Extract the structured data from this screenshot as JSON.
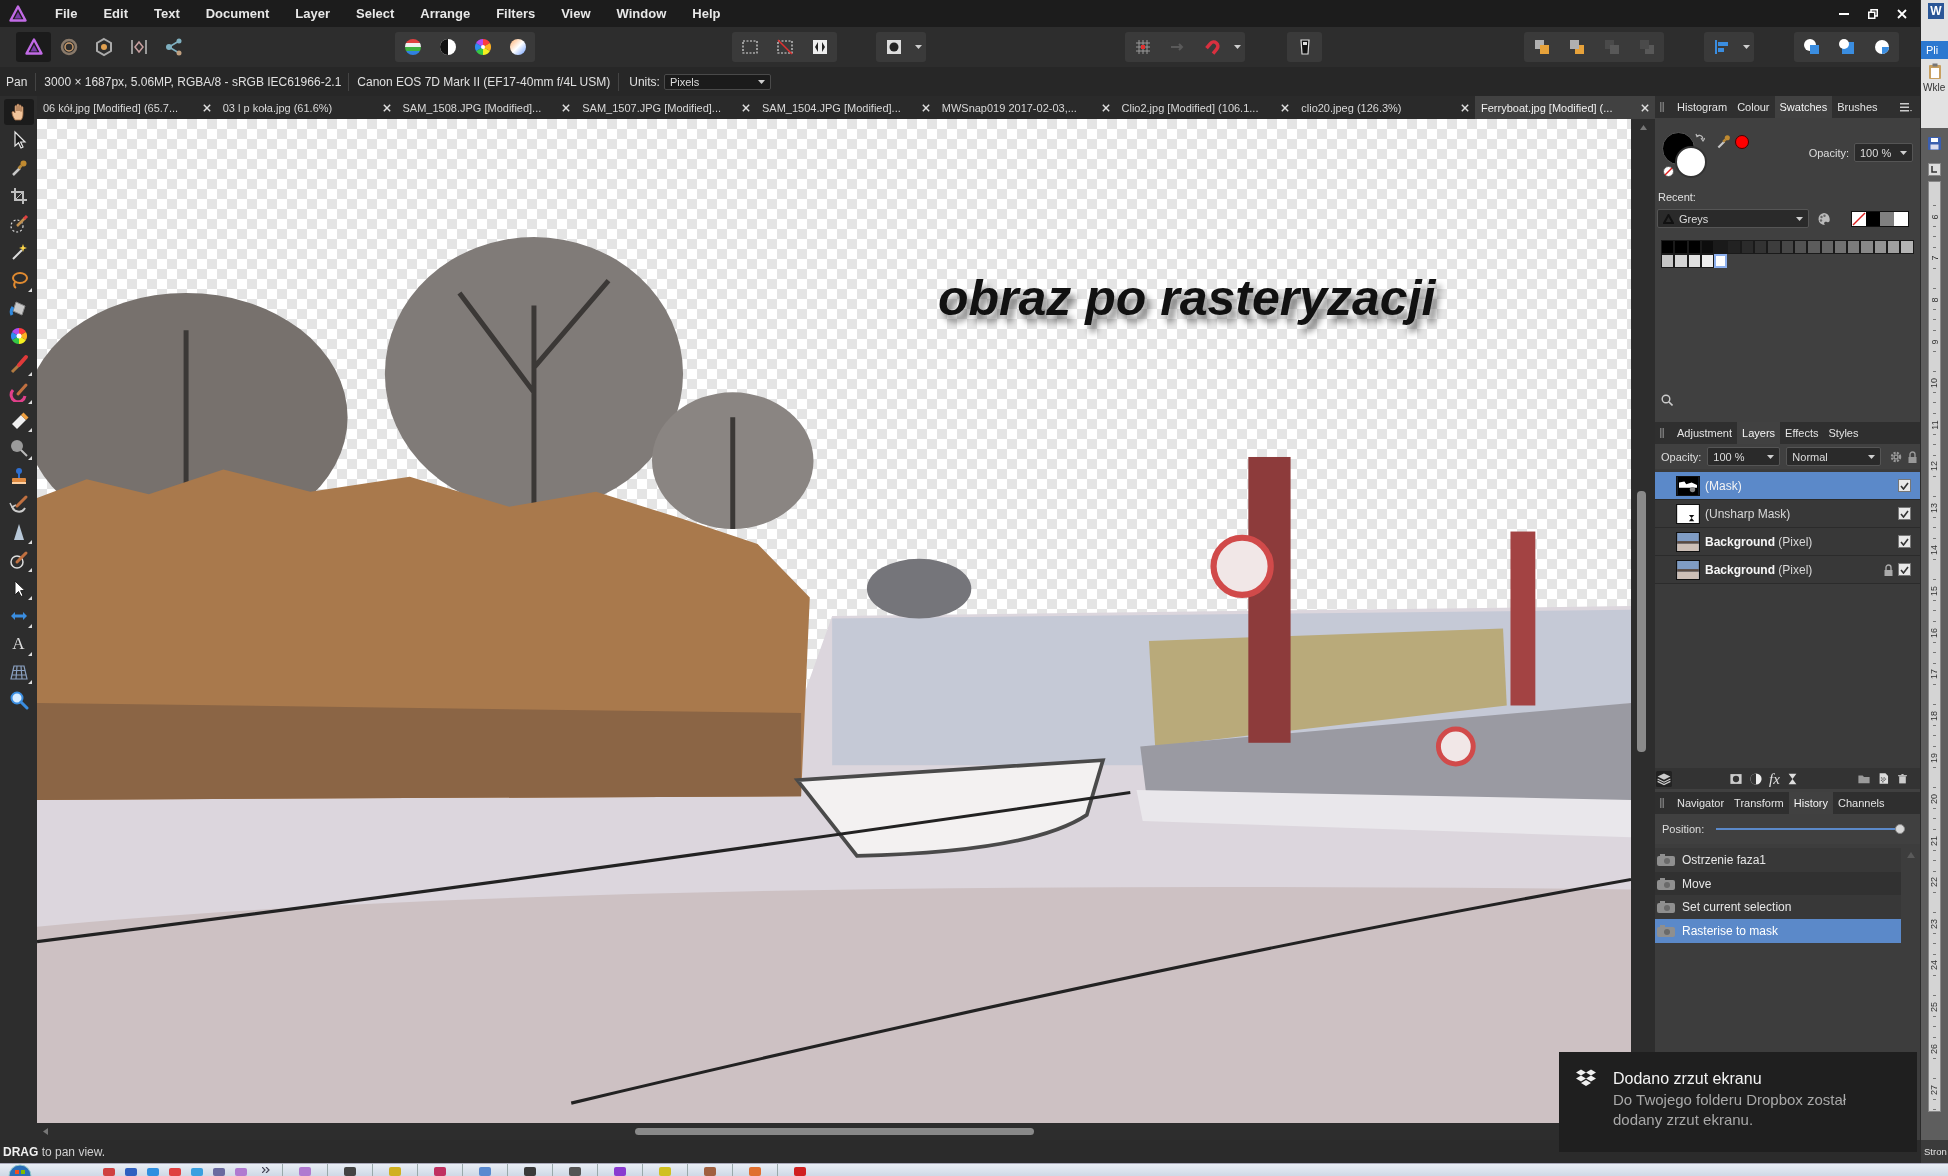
{
  "menu_bar": {
    "items": [
      "File",
      "Edit",
      "Text",
      "Document",
      "Layer",
      "Select",
      "Arrange",
      "Filters",
      "View",
      "Window",
      "Help"
    ]
  },
  "toolbar": {
    "personas": [
      {
        "selected": true
      },
      {
        "selected": false
      },
      {
        "selected": false
      },
      {
        "selected": false
      },
      {
        "selected": false
      }
    ],
    "arrange_buttons": [
      {
        "disabled": false
      },
      {
        "disabled": false
      },
      {
        "disabled": true
      },
      {
        "disabled": true
      }
    ]
  },
  "context_bar": {
    "tool": "Pan",
    "document_info": "3000 × 1687px, 5.06MP, RGBA/8 - sRGB IEC61966-2.1",
    "camera": "Canon EOS 7D Mark II (EF17-40mm f/4L USM)",
    "units_label": "Units:",
    "units_value": "Pixels"
  },
  "tools": [
    {
      "selected": true
    },
    {
      "selected": false
    },
    {
      "selected": false
    },
    {
      "selected": false
    },
    {
      "selected": false
    },
    {
      "selected": false
    },
    {
      "selected": false
    },
    {
      "selected": false
    },
    {
      "selected": false
    },
    {
      "selected": false
    },
    {
      "selected": false
    },
    {
      "selected": false
    },
    {
      "selected": false
    },
    {
      "selected": false
    },
    {
      "selected": false
    },
    {
      "selected": false
    },
    {
      "selected": false
    },
    {
      "selected": false
    },
    {
      "selected": false
    },
    {
      "selected": false,
      "glyph": "A"
    },
    {
      "selected": false
    },
    {
      "selected": false
    }
  ],
  "document_tabs": [
    {
      "label": "06 kół.jpg [Modified] (65.7...",
      "selected": false
    },
    {
      "label": "03 l p koła.jpg (61.6%)",
      "selected": false
    },
    {
      "label": "SAM_1508.JPG [Modified]...",
      "selected": false
    },
    {
      "label": "SAM_1507.JPG [Modified]...",
      "selected": false
    },
    {
      "label": "SAM_1504.JPG [Modified]...",
      "selected": false
    },
    {
      "label": "MWSnap019 2017-02-03,...",
      "selected": false
    },
    {
      "label": "Clio2.jpg [Modified] (106.1...",
      "selected": false
    },
    {
      "label": "clio20.jpeg (126.3%)",
      "selected": false
    },
    {
      "label": "Ferryboat.jpg [Modified] (...",
      "selected": true
    }
  ],
  "canvas": {
    "caption": "obraz po rasteryzacji"
  },
  "colour_panel": {
    "tabs": [
      {
        "label": "Histogram",
        "selected": false
      },
      {
        "label": "Colour",
        "selected": false
      },
      {
        "label": "Swatches",
        "selected": true
      },
      {
        "label": "Brushes",
        "selected": false
      }
    ],
    "opacity_label": "Opacity:",
    "opacity_value": "100 %",
    "recent_label": "Recent:",
    "palette_name": "Greys",
    "recent_swatches": [
      {
        "kind": "none"
      },
      {
        "kind": "solid",
        "color": "#000000"
      },
      {
        "kind": "solid",
        "color": "#808080"
      },
      {
        "kind": "solid",
        "color": "#ffffff"
      }
    ],
    "swatches": [
      {
        "color": "#000000",
        "selected": false
      },
      {
        "color": "#000000",
        "selected": false
      },
      {
        "color": "#000000",
        "selected": false
      },
      {
        "color": "#0d0d0d",
        "selected": false
      },
      {
        "color": "#1a1a1a",
        "selected": false
      },
      {
        "color": "#222222",
        "selected": false
      },
      {
        "color": "#2b2b2b",
        "selected": false
      },
      {
        "color": "#333333",
        "selected": false
      },
      {
        "color": "#3d3d3d",
        "selected": false
      },
      {
        "color": "#474747",
        "selected": false
      },
      {
        "color": "#525252",
        "selected": false
      },
      {
        "color": "#5c5c5c",
        "selected": false
      },
      {
        "color": "#666666",
        "selected": false
      },
      {
        "color": "#717171",
        "selected": false
      },
      {
        "color": "#7c7c7c",
        "selected": false
      },
      {
        "color": "#888888",
        "selected": false
      },
      {
        "color": "#939393",
        "selected": false
      },
      {
        "color": "#9f9f9f",
        "selected": false
      },
      {
        "color": "#b4b4b4",
        "selected": false
      },
      {
        "color": "#c6c6c6",
        "selected": false
      },
      {
        "color": "#d4d4d4",
        "selected": false
      },
      {
        "color": "#e0e0e0",
        "selected": false
      },
      {
        "color": "#eeeeee",
        "selected": false
      },
      {
        "color": "#ffffff",
        "selected": true
      }
    ]
  },
  "layers_panel": {
    "tabs": [
      {
        "label": "Adjustment",
        "selected": false
      },
      {
        "label": "Layers",
        "selected": true
      },
      {
        "label": "Effects",
        "selected": false
      },
      {
        "label": "Styles",
        "selected": false
      }
    ],
    "opacity_label": "Opacity:",
    "opacity_value": "100 %",
    "blend_mode": "Normal",
    "layers": [
      {
        "name": "(Mask)",
        "kind": "mask",
        "selected": true,
        "visible": true,
        "locked": false
      },
      {
        "name": "(Unsharp Mask)",
        "kind": "filter",
        "selected": false,
        "visible": true,
        "locked": false
      },
      {
        "name": "**Background** (Pixel)",
        "kind": "pixel",
        "selected": false,
        "visible": true,
        "locked": false
      },
      {
        "name": "**Background** (Pixel)",
        "kind": "pixel",
        "selected": false,
        "visible": true,
        "locked": true
      }
    ],
    "fx_label": "fx"
  },
  "history_panel": {
    "tabs": [
      {
        "label": "Navigator",
        "selected": false
      },
      {
        "label": "Transform",
        "selected": false
      },
      {
        "label": "History",
        "selected": true
      },
      {
        "label": "Channels",
        "selected": false
      }
    ],
    "position_label": "Position:",
    "position": {
      "level": 1
    },
    "entries": [
      {
        "label": "Ostrzenie faza1",
        "selected": false
      },
      {
        "label": "Move",
        "selected": false
      },
      {
        "label": "Set current selection",
        "selected": false
      },
      {
        "label": "Rasterise to mask",
        "selected": true
      }
    ]
  },
  "status_bar": {
    "hint": "**DRAG** to pan view."
  },
  "notification": {
    "title": "Dodano zrzut ekranu",
    "message": "Do Twojego folderu Dropbox został dodany zrzut ekranu."
  },
  "background_window": {
    "logo_letter": "W",
    "ribbon_tab": "Pli",
    "paste_label": "Wkle",
    "ruler_numbers": [
      "6",
      "7",
      "8",
      "9",
      "10",
      "11",
      "12",
      "13",
      "14",
      "15",
      "16",
      "17",
      "18",
      "19",
      "20",
      "21",
      "22",
      "23",
      "24",
      "25",
      "26",
      "27"
    ],
    "status_text": "Stron"
  }
}
